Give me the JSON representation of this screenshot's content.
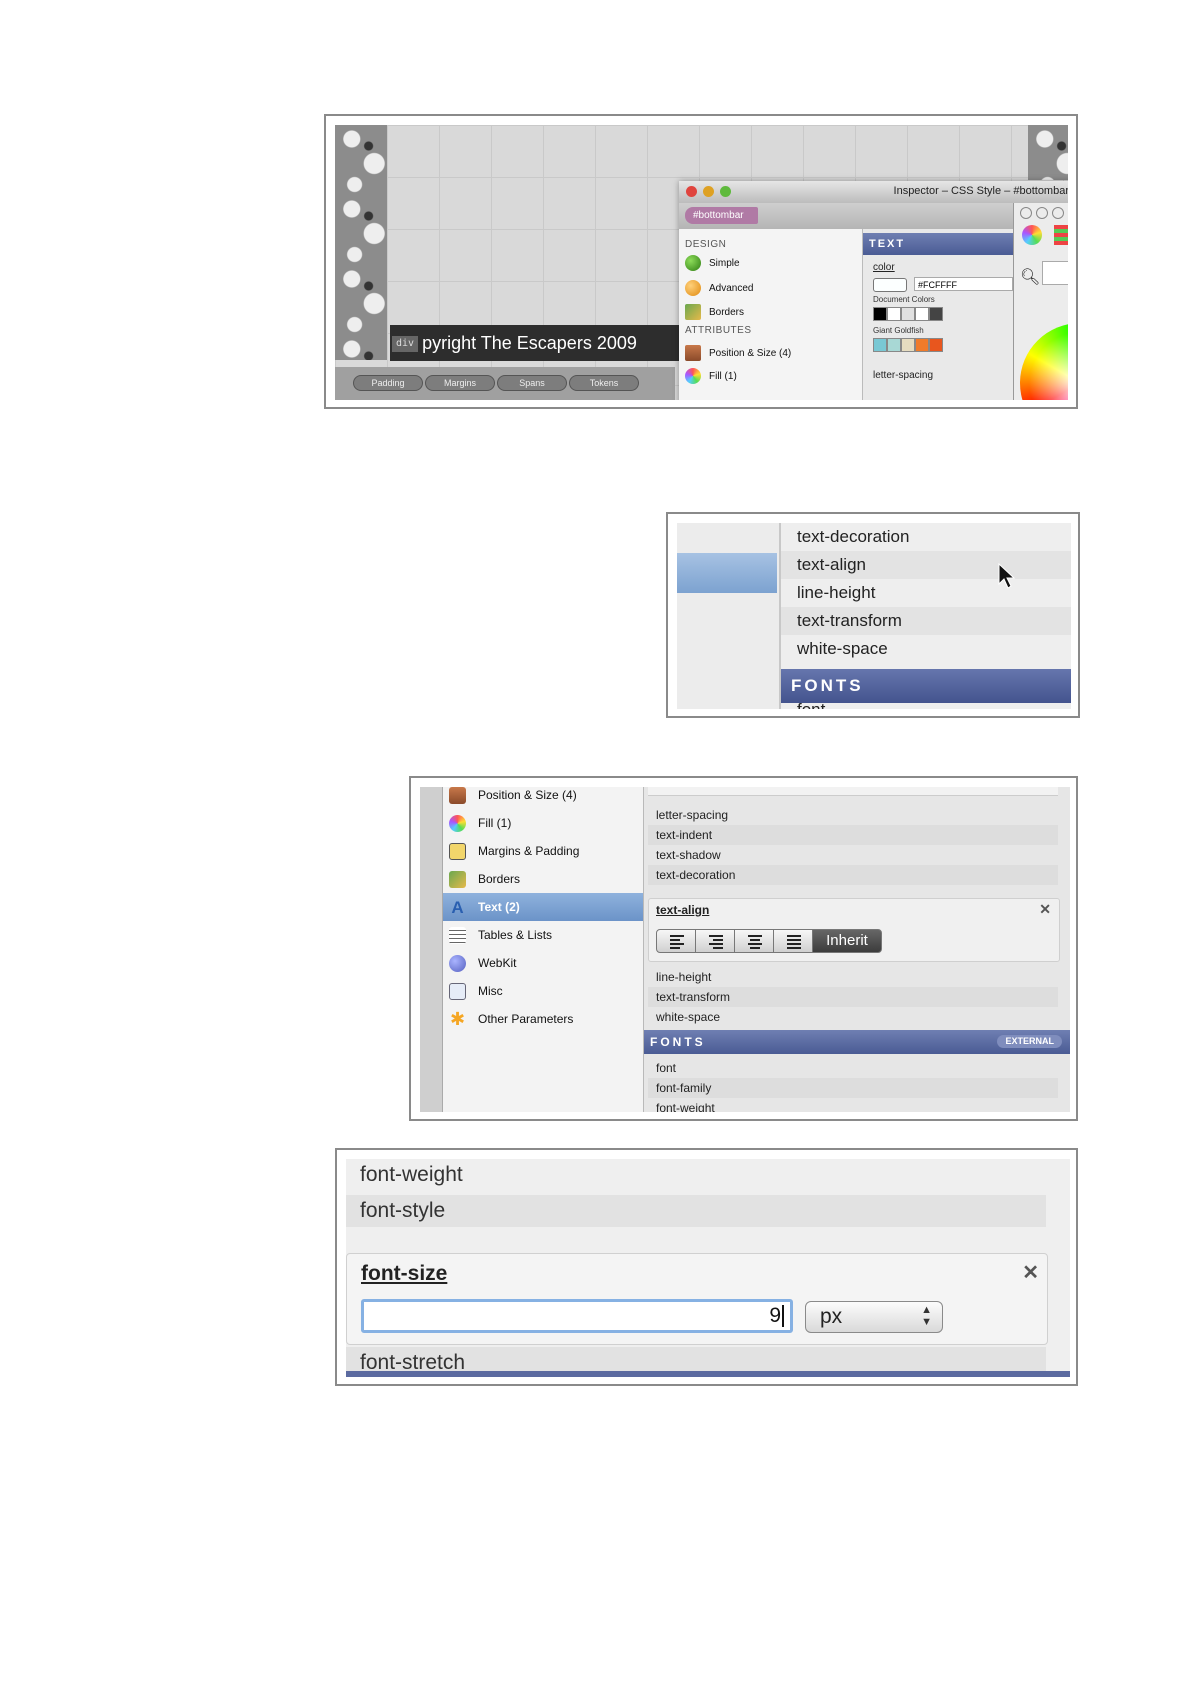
{
  "shot1": {
    "footer_text": "pyright The Escapers 2009",
    "div_tag": "div",
    "bottom_tabs": [
      "Padding",
      "Margins",
      "Spans",
      "Tokens"
    ],
    "inspector": {
      "title": "Inspector – CSS Style – #bottombar",
      "breadcrumb": "#bottombar",
      "design_label": "DESIGN",
      "design_items": [
        "Simple",
        "Advanced",
        "Borders"
      ],
      "attributes_label": "ATTRIBUTES",
      "attribute_items": [
        "Position & Size (4)",
        "Fill (1)"
      ],
      "text_section": "TEXT",
      "color_label": "color",
      "color_value": "#FCFFFF",
      "document_colors_label": "Document Colors",
      "giant_goldfish_label": "Giant Goldfish",
      "letter_spacing": "letter-spacing"
    },
    "colors": {
      "document": [
        "#000000",
        "#ffffff",
        "#e0e0e0",
        "#ffffff",
        "#444444"
      ],
      "goldfish": [
        "#79c8d4",
        "#a8d8d5",
        "#e6dcc0",
        "#f07b2a",
        "#e8561e"
      ]
    }
  },
  "shot2": {
    "rows": [
      "text-decoration",
      "text-align",
      "line-height",
      "text-transform",
      "white-space"
    ],
    "fonts_header": "FONTS",
    "partial_row": "font"
  },
  "shot3": {
    "left_items": [
      "Position & Size (4)",
      "Fill (1)",
      "Margins & Padding",
      "Borders",
      "Text (2)",
      "Tables & Lists",
      "WebKit",
      "Misc",
      "Other Parameters"
    ],
    "right_rows_top": [
      "letter-spacing",
      "text-indent",
      "text-shadow",
      "text-decoration"
    ],
    "text_align_label": "text-align",
    "inherit_label": "Inherit",
    "right_rows_mid": [
      "line-height",
      "text-transform",
      "white-space"
    ],
    "fonts_header": "FONTS",
    "external_badge": "EXTERNAL",
    "font_rows": [
      "font",
      "font-family",
      "font-weight"
    ]
  },
  "shot4": {
    "rows_top": [
      "font-weight",
      "font-style"
    ],
    "font_size_label": "font-size",
    "font_size_value": "9",
    "unit": "px",
    "row_bottom": "font-stretch"
  }
}
